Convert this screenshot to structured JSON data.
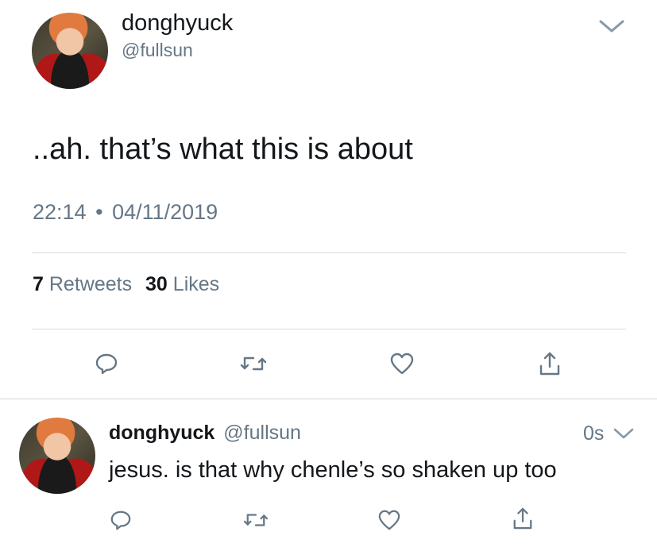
{
  "main_tweet": {
    "display_name": "donghyuck",
    "handle": "@fullsun",
    "text": "..ah. that’s what this is about",
    "time": "22:14",
    "separator": "•",
    "date": "04/11/2019",
    "retweets_count": "7",
    "retweets_label": "Retweets",
    "likes_count": "30",
    "likes_label": "Likes"
  },
  "reply": {
    "display_name": "donghyuck",
    "handle": "@fullsun",
    "time_ago": "0s",
    "text": "jesus. is that why chenle’s so shaken up too"
  },
  "icons": {
    "reply": "reply-icon",
    "retweet": "retweet-icon",
    "like": "heart-icon",
    "share": "share-icon",
    "menu": "chevron-down-icon"
  },
  "colors": {
    "muted": "#657786",
    "divider": "#d7dde2",
    "text": "#14171a"
  }
}
